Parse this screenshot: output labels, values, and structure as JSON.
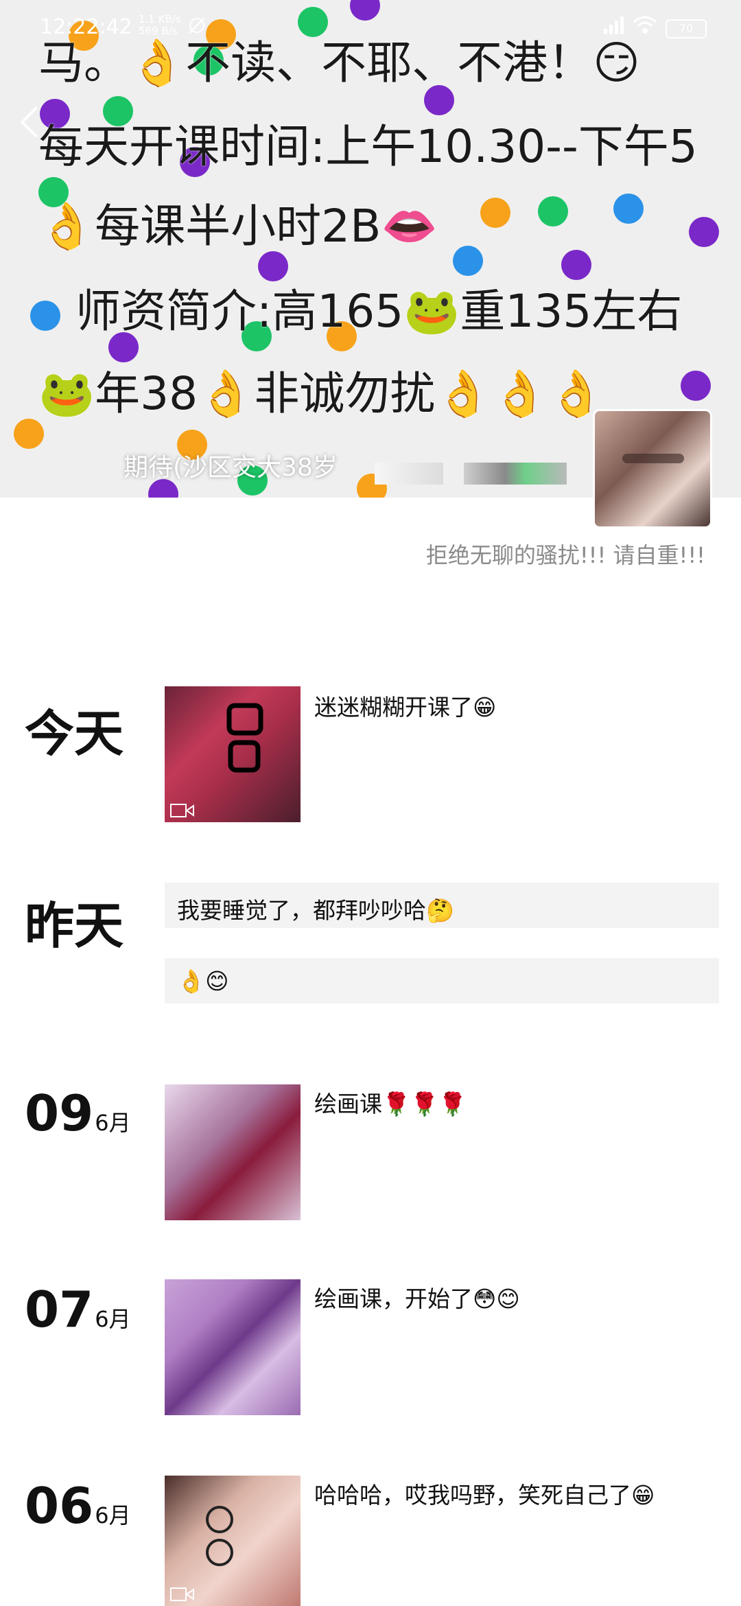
{
  "status_bar": {
    "time": "12:22:42",
    "net_up": "1.1 KB/s",
    "net_down": "569 B/s",
    "battery": "70"
  },
  "cover": {
    "lines": [
      "马。👌不读、不耶、不港！😏",
      "每天开课时间:上午10.30--下午5",
      "👌每课半小时2B👄",
      "师资简介:高165🐸重135左右",
      "🐸年38👌非诚勿扰👌👌👌"
    ]
  },
  "profile": {
    "nickname": "期待(沙区交大38岁",
    "signature": "拒绝无聊的骚扰!!! 请自重!!!"
  },
  "timeline": {
    "today_label": "今天",
    "yesterday_label": "昨天",
    "month_label": "6月",
    "posts": [
      {
        "text": "迷迷糊糊开课了😁"
      },
      {
        "text": "我要睡觉了，都拜吵吵哈🤔"
      },
      {
        "text": "👌😊"
      },
      {
        "day": "09",
        "text": "绘画课🌹🌹🌹"
      },
      {
        "day": "07",
        "text": "绘画课，开始了😳😊"
      },
      {
        "day": "06",
        "text": "哈哈哈，哎我吗野，笑死自己了😁"
      }
    ]
  },
  "colors": {
    "dot_orange": "#f7a21a",
    "dot_green": "#1cc466",
    "dot_purple": "#7a28c8",
    "dot_blue": "#2a92e8"
  }
}
